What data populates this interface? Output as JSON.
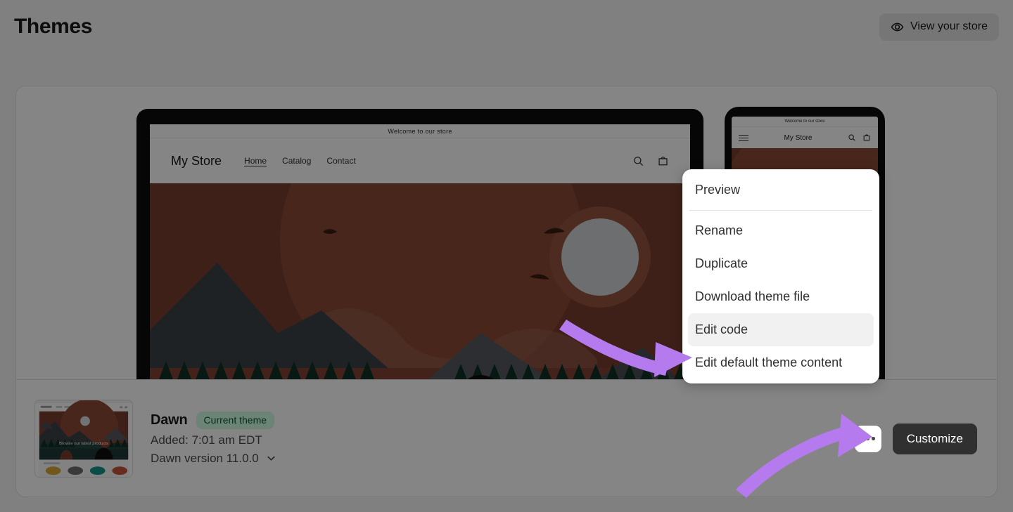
{
  "header": {
    "title": "Themes",
    "view_store_label": "View your store",
    "eye_icon": "eye-icon"
  },
  "preview": {
    "desktop": {
      "announcement": "Welcome to our store",
      "logo": "My Store",
      "nav": [
        "Home",
        "Catalog",
        "Contact"
      ],
      "active_nav": "Home",
      "icons": [
        "search-icon",
        "cart-icon"
      ]
    },
    "mobile": {
      "announcement": "Welcome to our store",
      "logo": "My Store",
      "icons": [
        "menu-icon",
        "search-icon",
        "cart-icon"
      ]
    }
  },
  "theme": {
    "name": "Dawn",
    "badge": "Current theme",
    "added": "Added: 7:01 am EDT",
    "version": "Dawn version 11.0.0",
    "thumbnail_caption": "Browse our latest products"
  },
  "actions": {
    "more_label": "•••",
    "customize_label": "Customize"
  },
  "menu": {
    "items": [
      {
        "label": "Preview",
        "active": false,
        "separator_after": true
      },
      {
        "label": "Rename",
        "active": false,
        "separator_after": false
      },
      {
        "label": "Duplicate",
        "active": false,
        "separator_after": false
      },
      {
        "label": "Download theme file",
        "active": false,
        "separator_after": false
      },
      {
        "label": "Edit code",
        "active": true,
        "separator_after": false
      },
      {
        "label": "Edit default theme content",
        "active": false,
        "separator_after": false
      }
    ]
  },
  "annotations": {
    "arrow_color": "#b57aee",
    "arrow_1_target": "Edit code",
    "arrow_2_target": "more-options-button"
  },
  "colors": {
    "page_background": "#f6f6f7",
    "card_background": "#ffffff",
    "badge_background": "#cdfee1",
    "badge_text": "#0c5132",
    "primary_button": "#303030",
    "accent_arrow": "#b57aee",
    "overlay": "rgba(0,0,0,0.48)"
  }
}
